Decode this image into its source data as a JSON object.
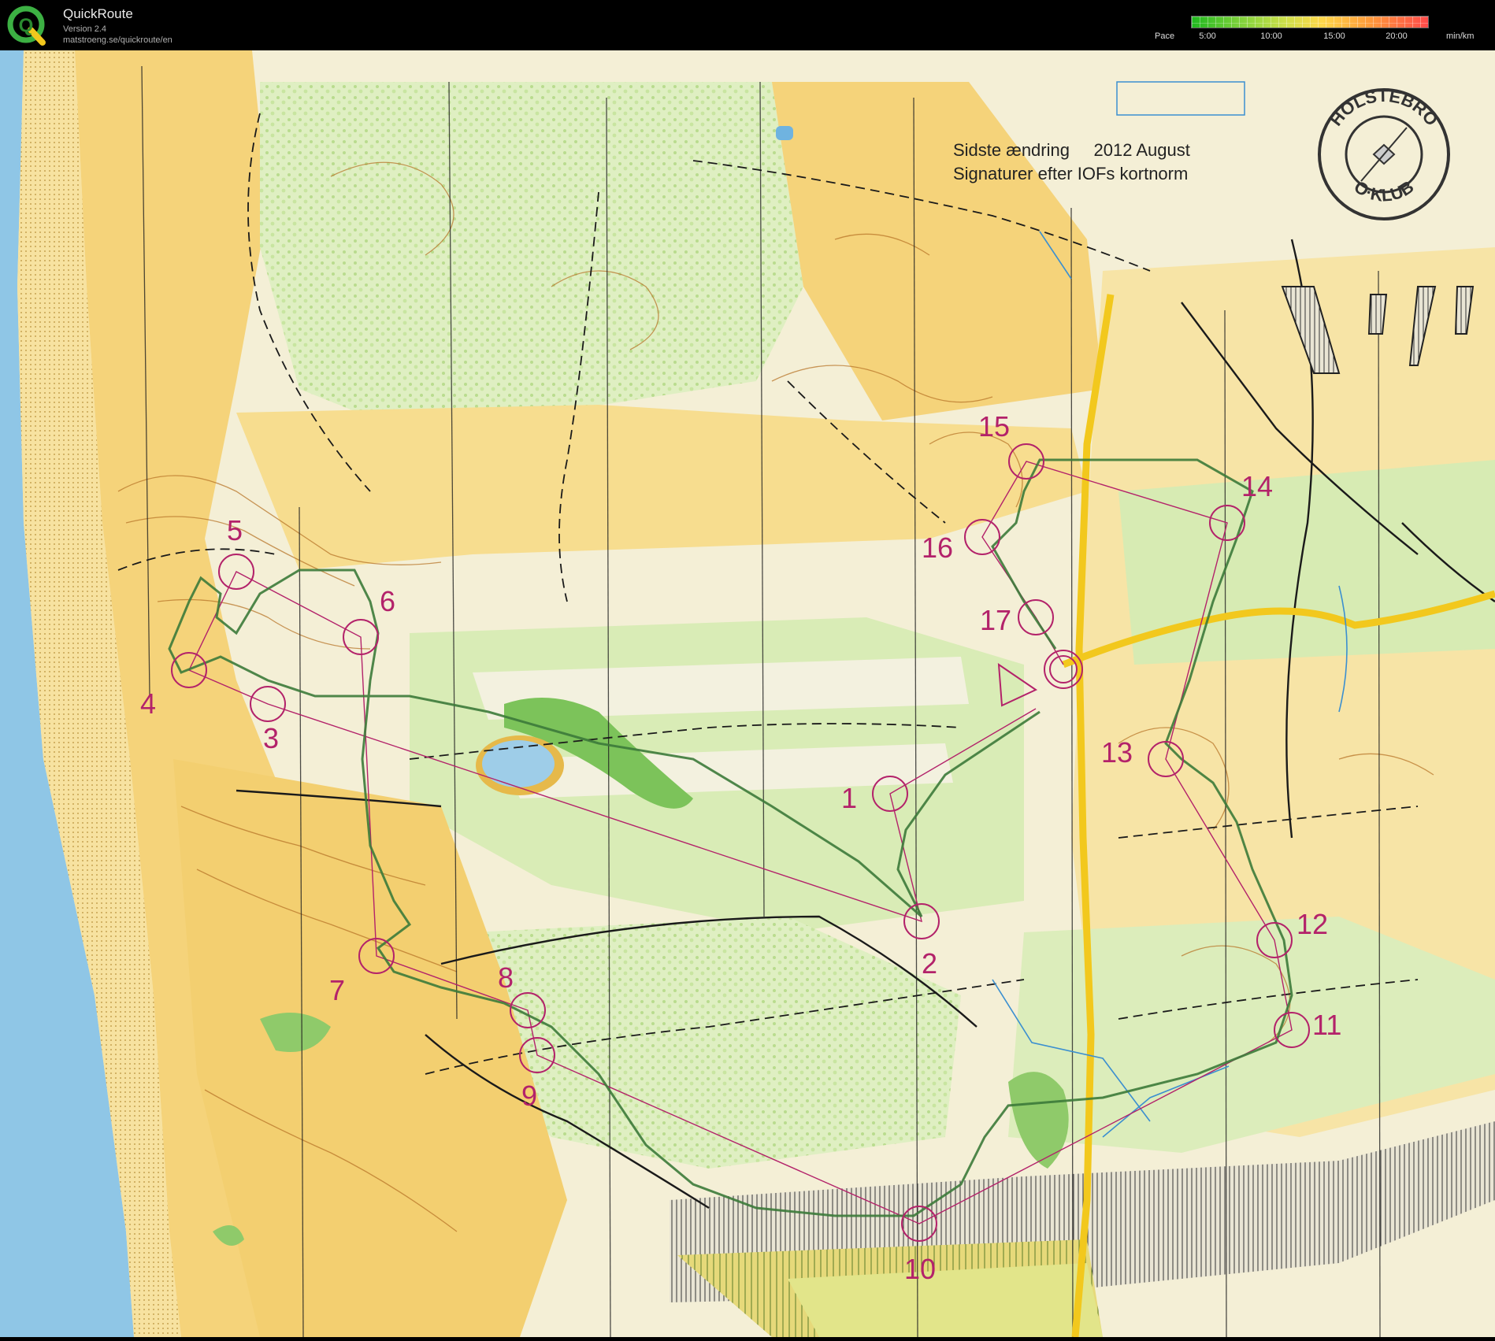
{
  "app": {
    "name": "QuickRoute",
    "version": "Version 2.4",
    "url": "matstroeng.se/quickroute/en",
    "logo_letter": "Q"
  },
  "pace_legend": {
    "label": "Pace",
    "ticks": [
      "5:00",
      "10:00",
      "15:00",
      "20:00"
    ],
    "unit": "min/km"
  },
  "map": {
    "note_line1": "Sidste ændring     2012 August",
    "note_line2": "Signaturer efter IOFs kortnorm",
    "club_logo": {
      "top_text": "HOLSTEBRO",
      "bottom_text": "O·KLUB"
    },
    "controls": [
      {
        "label": "1"
      },
      {
        "label": "2"
      },
      {
        "label": "3"
      },
      {
        "label": "4"
      },
      {
        "label": "5"
      },
      {
        "label": "6"
      },
      {
        "label": "7"
      },
      {
        "label": "8"
      },
      {
        "label": "9"
      },
      {
        "label": "10"
      },
      {
        "label": "11"
      },
      {
        "label": "12"
      },
      {
        "label": "13"
      },
      {
        "label": "14"
      },
      {
        "label": "15"
      },
      {
        "label": "16"
      },
      {
        "label": "17"
      }
    ]
  },
  "colors": {
    "header_bg": "#000000",
    "paper": "#f4efd6",
    "open_land": "#f5d37a",
    "rough_open": "#fbe8a8",
    "forest_green": "#cfe6a8",
    "dense_green": "#8fca6a",
    "contour": "#b8762a",
    "course": "#b3226a",
    "route": "#3c7a3a",
    "water": "#8fc6e6",
    "road_yellow": "#f2c81d",
    "path_black": "#1a1a1a"
  }
}
